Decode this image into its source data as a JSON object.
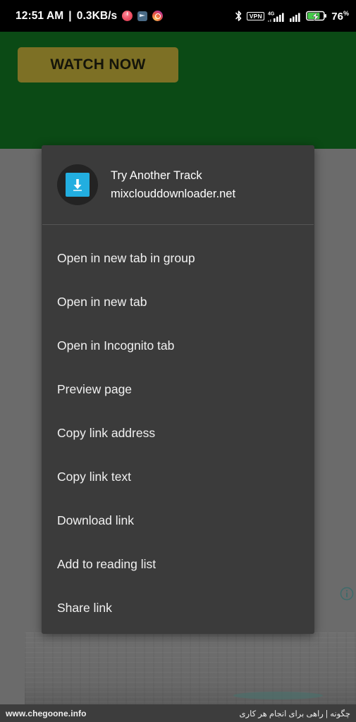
{
  "status_bar": {
    "time": "12:51 AM",
    "separator": "|",
    "network_speed": "0.3KB/s",
    "notification_icons": [
      "music-app-icon",
      "telegram-icon",
      "instagram-icon"
    ],
    "bluetooth_icon": "bluetooth-icon",
    "vpn_label": "VPN",
    "network_type": "4G",
    "battery_percent": "76",
    "battery_percent_symbol": "%",
    "battery_state": "charging"
  },
  "page": {
    "banner": {
      "background_color": "#0b4a15",
      "cta_label": "WATCH NOW",
      "cta_color": "#7d7025"
    },
    "info_icon": "info-circle-icon",
    "footer": {
      "site": "www.chegoone.info",
      "tagline": "چگونه | راهی برای انجام هر کاری"
    }
  },
  "context_menu": {
    "title": "Try Another Track",
    "subtitle": "mixclouddownloader.net",
    "favicon": "download-arrow-icon",
    "favicon_color": "#22aee0",
    "background_color": "#3b3b3b",
    "items": [
      {
        "label": "Open in new tab in group"
      },
      {
        "label": "Open in new tab"
      },
      {
        "label": "Open in Incognito tab"
      },
      {
        "label": "Preview page"
      },
      {
        "label": "Copy link address"
      },
      {
        "label": "Copy link text"
      },
      {
        "label": "Download link"
      },
      {
        "label": "Add to reading list"
      },
      {
        "label": "Share link"
      }
    ]
  }
}
